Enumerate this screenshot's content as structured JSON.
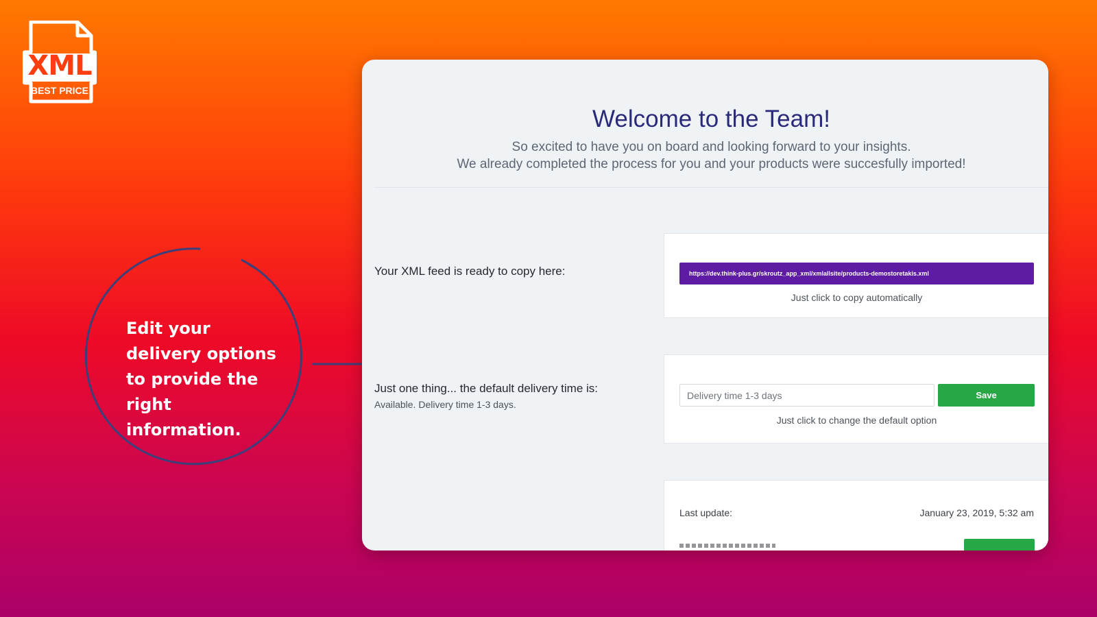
{
  "logo": {
    "main_text": "XML",
    "sub_text": "BEST PRICE",
    "icon": "file-icon"
  },
  "callout": {
    "text": "Edit your delivery options to provide the right information.",
    "ring_color": "#3d3f7a",
    "arrow_icon": "arrow-right-icon"
  },
  "welcome": {
    "title": "Welcome to the Team!",
    "subtitle_line1": "So excited to have you on board and looking forward to your insights.",
    "subtitle_line2": "We already completed the process for you and your products were succesfully imported!"
  },
  "feed": {
    "label": "Your XML feed is ready to copy here:",
    "url": "https://dev.think-plus.gr/skroutz_app_xml/xmlallsite/products-demostoretakis.xml",
    "hint": "Just click to copy automatically"
  },
  "delivery": {
    "label": "Just one thing... the default delivery time is:",
    "current": "Available. Delivery time 1-3 days.",
    "placeholder": "Delivery time 1-3 days",
    "save_label": "Save",
    "hint": "Just click to change the default option"
  },
  "status": {
    "last_update_label": "Last update:",
    "last_update_value": "January 23, 2019, 5:32 am"
  },
  "colors": {
    "primary_purple": "#5e1ba3",
    "save_green": "#28a745",
    "title_navy": "#2a2a7a"
  }
}
